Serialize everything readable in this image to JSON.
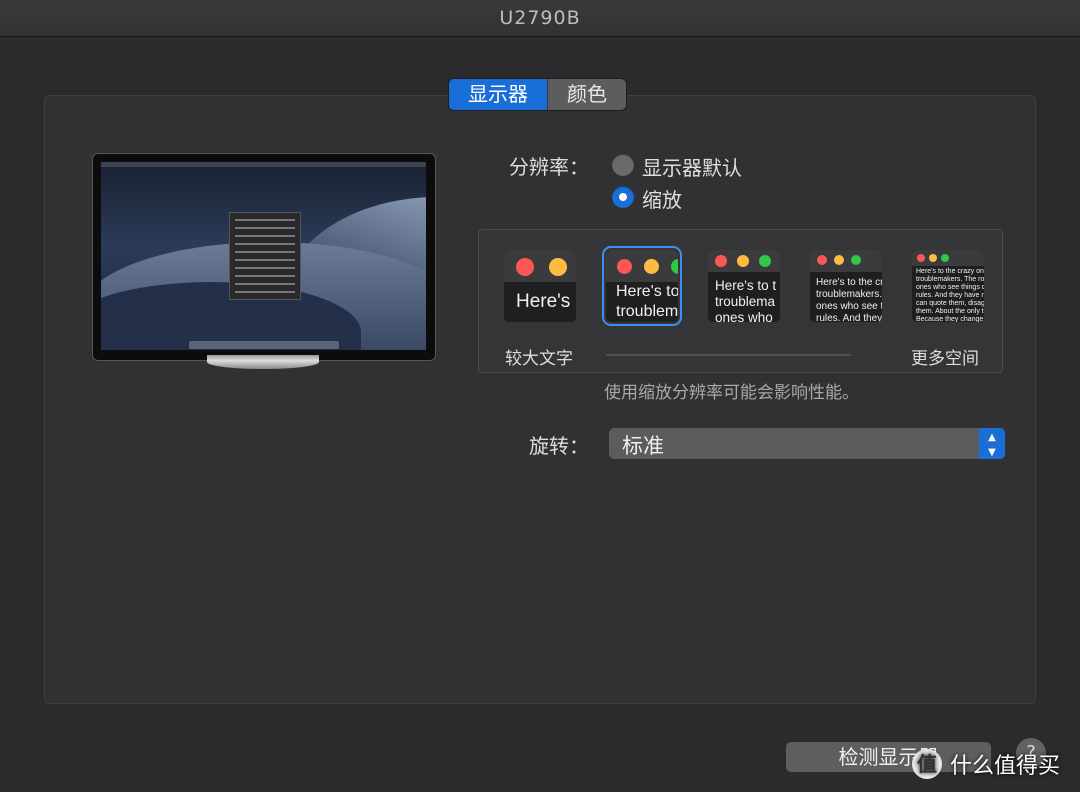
{
  "window": {
    "title": "U2790B"
  },
  "tabs": [
    {
      "label": "显示器",
      "selected": true
    },
    {
      "label": "颜色",
      "selected": false
    }
  ],
  "resolution": {
    "label": "分辨率：",
    "options": [
      {
        "label": "显示器默认",
        "selected": false
      },
      {
        "label": "缩放",
        "selected": true
      }
    ]
  },
  "scaling": {
    "thumbnails": [
      {
        "text": "Here's"
      },
      {
        "text": "Here's to\ntroublem"
      },
      {
        "text": "Here's to t\ntroublema\nones who"
      },
      {
        "text": "Here's to the cr\ntroublemakers.\nones who see t\nrules. And they"
      },
      {
        "text": "Here's to the crazy ones\ntroublemakers. The rou\nones who see things dif\nrules. And they have no\ncan quote them, disagr\nthem. About the only th\nBecause they change th"
      }
    ],
    "selected_index": 1,
    "left_label": "较大文字",
    "right_label": "更多空间",
    "note": "使用缩放分辨率可能会影响性能。"
  },
  "rotation": {
    "label": "旋转：",
    "value": "标准"
  },
  "buttons": {
    "detect": "检测显示器",
    "help": "?"
  },
  "watermark": {
    "logo": "值",
    "text": "什么值得买"
  },
  "colors": {
    "accent": "#1a6ed8",
    "close": "#fc5753",
    "minimize": "#fdbc40",
    "zoom": "#33c748"
  }
}
